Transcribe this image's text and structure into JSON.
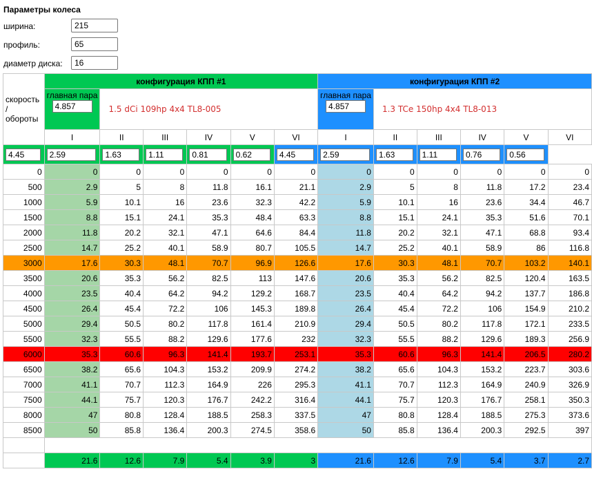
{
  "params": {
    "title": "Параметры колеса",
    "width_label": "ширина:",
    "width_value": "215",
    "profile_label": "профиль:",
    "profile_value": "65",
    "diameter_label": "диаметр диска:",
    "diameter_value": "16"
  },
  "speed_header": "скорость / обороты",
  "configs": [
    {
      "title": "конфигурация КПП #1",
      "main_pair_label": "главная пара",
      "main_pair_value": "4.857",
      "name": "1.5 dCi 109hp 4x4 TL8-005",
      "gears": [
        "I",
        "II",
        "III",
        "IV",
        "V",
        "VI"
      ],
      "ratios": [
        "4.45",
        "2.59",
        "1.63",
        "1.11",
        "0.81",
        "0.62"
      ],
      "footer": [
        "21.6",
        "12.6",
        "7.9",
        "5.4",
        "3.9",
        "3"
      ],
      "accent": "#00c853",
      "first_gear_color": "#a5d6a7"
    },
    {
      "title": "конфигурация КПП #2",
      "main_pair_label": "главная пара",
      "main_pair_value": "4.857",
      "name": "1.3 TCe 150hp 4x4 TL8-013",
      "gears": [
        "I",
        "II",
        "III",
        "IV",
        "V",
        "VI"
      ],
      "ratios": [
        "4.45",
        "2.59",
        "1.63",
        "1.11",
        "0.76",
        "0.56"
      ],
      "footer": [
        "21.6",
        "12.6",
        "7.9",
        "5.4",
        "3.7",
        "2.7"
      ],
      "accent": "#1e90ff",
      "first_gear_color": "#add8e6"
    }
  ],
  "rows": [
    {
      "rpm": "0",
      "c1": [
        "0",
        "0",
        "0",
        "0",
        "0",
        "0"
      ],
      "c2": [
        "0",
        "0",
        "0",
        "0",
        "0",
        "0"
      ]
    },
    {
      "rpm": "500",
      "c1": [
        "2.9",
        "5",
        "8",
        "11.8",
        "16.1",
        "21.1"
      ],
      "c2": [
        "2.9",
        "5",
        "8",
        "11.8",
        "17.2",
        "23.4"
      ]
    },
    {
      "rpm": "1000",
      "c1": [
        "5.9",
        "10.1",
        "16",
        "23.6",
        "32.3",
        "42.2"
      ],
      "c2": [
        "5.9",
        "10.1",
        "16",
        "23.6",
        "34.4",
        "46.7"
      ]
    },
    {
      "rpm": "1500",
      "c1": [
        "8.8",
        "15.1",
        "24.1",
        "35.3",
        "48.4",
        "63.3"
      ],
      "c2": [
        "8.8",
        "15.1",
        "24.1",
        "35.3",
        "51.6",
        "70.1"
      ]
    },
    {
      "rpm": "2000",
      "c1": [
        "11.8",
        "20.2",
        "32.1",
        "47.1",
        "64.6",
        "84.4"
      ],
      "c2": [
        "11.8",
        "20.2",
        "32.1",
        "47.1",
        "68.8",
        "93.4"
      ]
    },
    {
      "rpm": "2500",
      "c1": [
        "14.7",
        "25.2",
        "40.1",
        "58.9",
        "80.7",
        "105.5"
      ],
      "c2": [
        "14.7",
        "25.2",
        "40.1",
        "58.9",
        "86",
        "116.8"
      ]
    },
    {
      "rpm": "3000",
      "hl": "orange",
      "c1": [
        "17.6",
        "30.3",
        "48.1",
        "70.7",
        "96.9",
        "126.6"
      ],
      "c2": [
        "17.6",
        "30.3",
        "48.1",
        "70.7",
        "103.2",
        "140.1"
      ]
    },
    {
      "rpm": "3500",
      "c1": [
        "20.6",
        "35.3",
        "56.2",
        "82.5",
        "113",
        "147.6"
      ],
      "c2": [
        "20.6",
        "35.3",
        "56.2",
        "82.5",
        "120.4",
        "163.5"
      ]
    },
    {
      "rpm": "4000",
      "c1": [
        "23.5",
        "40.4",
        "64.2",
        "94.2",
        "129.2",
        "168.7"
      ],
      "c2": [
        "23.5",
        "40.4",
        "64.2",
        "94.2",
        "137.7",
        "186.8"
      ]
    },
    {
      "rpm": "4500",
      "c1": [
        "26.4",
        "45.4",
        "72.2",
        "106",
        "145.3",
        "189.8"
      ],
      "c2": [
        "26.4",
        "45.4",
        "72.2",
        "106",
        "154.9",
        "210.2"
      ]
    },
    {
      "rpm": "5000",
      "c1": [
        "29.4",
        "50.5",
        "80.2",
        "117.8",
        "161.4",
        "210.9"
      ],
      "c2": [
        "29.4",
        "50.5",
        "80.2",
        "117.8",
        "172.1",
        "233.5"
      ]
    },
    {
      "rpm": "5500",
      "c1": [
        "32.3",
        "55.5",
        "88.2",
        "129.6",
        "177.6",
        "232"
      ],
      "c2": [
        "32.3",
        "55.5",
        "88.2",
        "129.6",
        "189.3",
        "256.9"
      ]
    },
    {
      "rpm": "6000",
      "hl": "red",
      "c1": [
        "35.3",
        "60.6",
        "96.3",
        "141.4",
        "193.7",
        "253.1"
      ],
      "c2": [
        "35.3",
        "60.6",
        "96.3",
        "141.4",
        "206.5",
        "280.2"
      ]
    },
    {
      "rpm": "6500",
      "c1": [
        "38.2",
        "65.6",
        "104.3",
        "153.2",
        "209.9",
        "274.2"
      ],
      "c2": [
        "38.2",
        "65.6",
        "104.3",
        "153.2",
        "223.7",
        "303.6"
      ]
    },
    {
      "rpm": "7000",
      "c1": [
        "41.1",
        "70.7",
        "112.3",
        "164.9",
        "226",
        "295.3"
      ],
      "c2": [
        "41.1",
        "70.7",
        "112.3",
        "164.9",
        "240.9",
        "326.9"
      ]
    },
    {
      "rpm": "7500",
      "c1": [
        "44.1",
        "75.7",
        "120.3",
        "176.7",
        "242.2",
        "316.4"
      ],
      "c2": [
        "44.1",
        "75.7",
        "120.3",
        "176.7",
        "258.1",
        "350.3"
      ]
    },
    {
      "rpm": "8000",
      "c1": [
        "47",
        "80.8",
        "128.4",
        "188.5",
        "258.3",
        "337.5"
      ],
      "c2": [
        "47",
        "80.8",
        "128.4",
        "188.5",
        "275.3",
        "373.6"
      ]
    },
    {
      "rpm": "8500",
      "c1": [
        "50",
        "85.8",
        "136.4",
        "200.3",
        "274.5",
        "358.6"
      ],
      "c2": [
        "50",
        "85.8",
        "136.4",
        "200.3",
        "292.5",
        "397"
      ]
    }
  ]
}
